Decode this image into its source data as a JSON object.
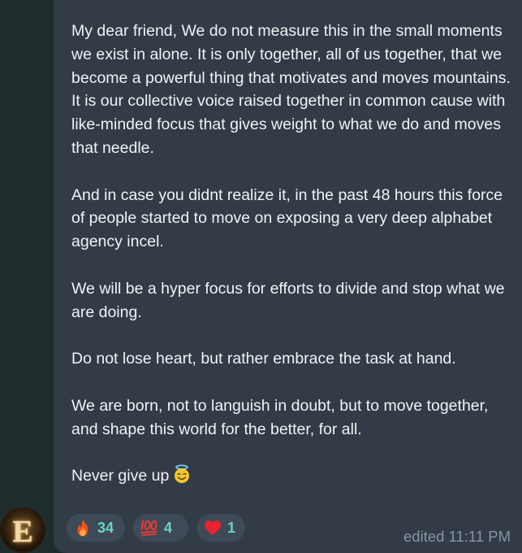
{
  "message": {
    "paragraphs": [
      "My dear friend, We do not measure this in the small moments we exist in alone. It is only together, all of us together, that we become a powerful thing that motivates and moves mountains. It is our collective voice raised together in common cause with  like-minded focus that gives weight to what we do and moves that needle.",
      "And in case you didnt realize it, in the past 48 hours this force of people started to move on exposing a very deep alphabet agency incel.",
      "We will be a hyper focus for efforts to divide and stop what we are doing.",
      "Do not lose heart, but rather embrace the task at hand.",
      "We are born, not to languish in doubt, but to move together, and shape this world for the better, for all."
    ],
    "closing": "Never give up",
    "closing_emoji": "smiling-face-with-halo-icon",
    "status": "edited 11:11 PM"
  },
  "reactions": [
    {
      "icon": "fire-icon",
      "count": "34"
    },
    {
      "icon": "hundred-points-icon",
      "count": "4"
    },
    {
      "icon": "red-heart-icon",
      "count": "1"
    }
  ],
  "avatar": {
    "letter": "E"
  },
  "colors": {
    "chat_background": "#1e2c2c",
    "bubble": "#323b46",
    "text": "#f1f3f5",
    "reaction_count": "#6ad4c6",
    "status": "#8795a3"
  }
}
